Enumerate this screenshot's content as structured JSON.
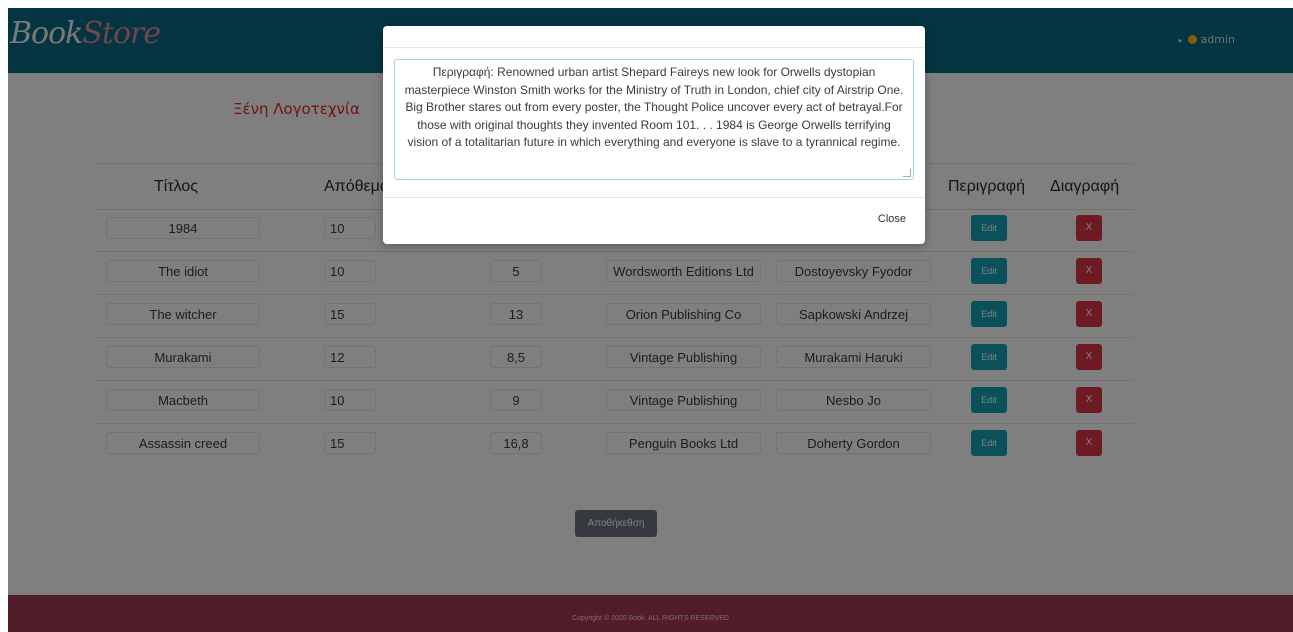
{
  "header": {
    "brand_part1": "Book",
    "brand_part2": "Store",
    "user_label": "admin"
  },
  "page": {
    "category_title": "Ξένη Λογοτεχνία"
  },
  "table": {
    "columns": {
      "title": "Τίτλος",
      "stock": "Απόθεμα",
      "description": "Περιγραφή",
      "delete": "Διαγραφή"
    },
    "rows": [
      {
        "title": "1984",
        "stock": "10"
      },
      {
        "title": "The idiot",
        "stock": "10",
        "price": "5",
        "publisher": "Wordsworth Editions Ltd",
        "author": "Dostoyevsky Fyodor"
      },
      {
        "title": "The witcher",
        "stock": "15",
        "price": "13",
        "publisher": "Orion Publishing Co",
        "author": "Sapkowski Andrzej"
      },
      {
        "title": "Murakami",
        "stock": "12",
        "price": "8,5",
        "publisher": "Vintage Publishing",
        "author": "Murakami Haruki"
      },
      {
        "title": "Macbeth",
        "stock": "10",
        "price": "9",
        "publisher": "Vintage Publishing",
        "author": "Nesbo Jo"
      },
      {
        "title": "Assassin creed",
        "stock": "15",
        "price": "16,8",
        "publisher": "Penguin Books Ltd",
        "author": "Doherty Gordon"
      }
    ],
    "edit_label": "Edit",
    "delete_label": "X"
  },
  "save_label": "Αποθήκεθση",
  "footer": {
    "copyright": "Copyright © 2020 Book. ALL RIGHTS RESERVED"
  },
  "modal": {
    "description": "Περιγραφή: Renowned urban artist Shepard Faireys new look for Orwells dystopian masterpiece Winston Smith works for the Ministry of Truth in London, chief city of Airstrip One. Big Brother stares out from every poster, the Thought Police uncover every act of betrayal.For those with original thoughts they invented Room 101. . . 1984 is George Orwells terrifying vision of a totalitarian future in which everything and everyone is slave to a tyrannical regime.",
    "close_label": "Close"
  },
  "colors": {
    "navbar": "#0b6a85",
    "footer": "#a43a52",
    "edit_button": "#17a2b8",
    "delete_button": "#dc3545",
    "category_title": "#e8242b"
  }
}
